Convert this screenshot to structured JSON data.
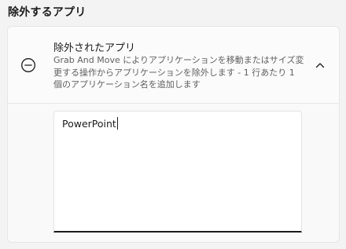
{
  "section": {
    "title": "除外するアプリ"
  },
  "excluded_apps": {
    "title": "除外されたアプリ",
    "description": "Grab And Move によりアプリケーションを移動またはサイズ変更する操作からアプリケーションを除外します - 1 行あたり 1 個のアプリケーション名を追加します",
    "icon": "circle-minus-icon",
    "expanded": true,
    "chevron_icon": "chevron-up-icon",
    "textarea_value": "PowerPoint"
  }
}
